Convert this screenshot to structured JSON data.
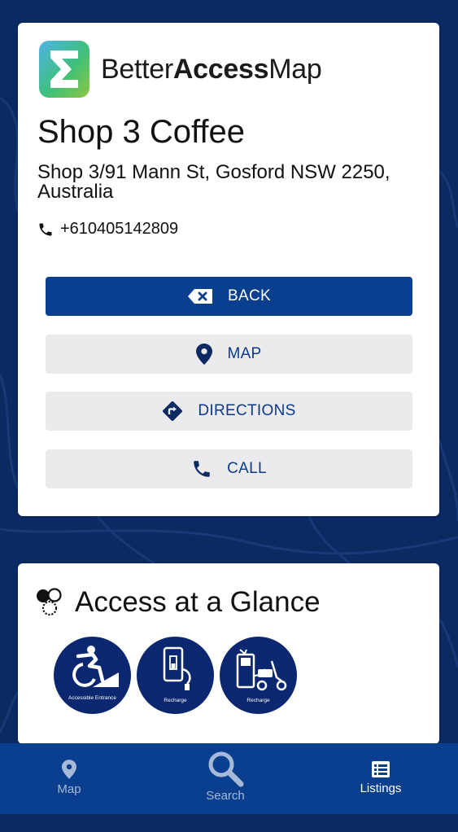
{
  "logo": {
    "text_light": "Better",
    "text_bold": "Access",
    "text_end": "Map",
    "icon": "sigma-logo-icon"
  },
  "place": {
    "title": "Shop 3 Coffee",
    "address": "Shop 3/91 Mann St, Gosford NSW 2250, Australia",
    "phone": "+610405142809"
  },
  "buttons": {
    "back": {
      "label": "BACK",
      "icon": "backspace-x-icon"
    },
    "map": {
      "label": "MAP",
      "icon": "map-pin-icon"
    },
    "directions": {
      "label": "DIRECTIONS",
      "icon": "directions-turn-icon"
    },
    "call": {
      "label": "CALL",
      "icon": "phone-icon"
    }
  },
  "access": {
    "title": "Access at a Glance",
    "icon": "access-dots-icon",
    "features": [
      {
        "label": "Accessible Entrance",
        "icon": "accessible-entrance-icon"
      },
      {
        "label": "Recharge",
        "icon": "phone-recharge-icon"
      },
      {
        "label": "Recharge",
        "icon": "scooter-recharge-icon"
      }
    ]
  },
  "tabs": [
    {
      "label": "Map",
      "icon": "map-pin-icon",
      "active": false
    },
    {
      "label": "Search",
      "icon": "search-icon",
      "active": false
    },
    {
      "label": "Listings",
      "icon": "list-icon",
      "active": true
    }
  ],
  "colors": {
    "background": "#0b2a62",
    "primary": "#0a3f8f",
    "button_bg": "#ebebee",
    "feature_bg": "#0b2770"
  }
}
